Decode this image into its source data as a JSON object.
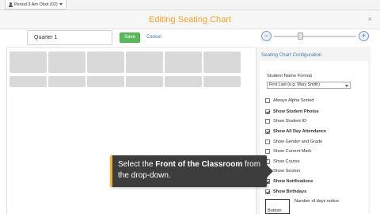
{
  "top_bar": {
    "period_label": "Period 3 Am Obot (02)"
  },
  "header": {
    "title": "Editing Seating Chart",
    "close_icon": "×"
  },
  "toolbar": {
    "chart_name_value": "Quarter 1",
    "save_label": "Save",
    "cancel_label": "Cancel",
    "zoom_out_symbol": "−",
    "zoom_in_symbol": "+",
    "zoom_level": 0.3
  },
  "sidebar": {
    "title": "Seating Chart Configuration",
    "name_format_label": "Student Name Format",
    "name_format_value": "First Last (e.g. Mary Smith)",
    "options": [
      {
        "label": "Always Alpha Sorted",
        "checked": false,
        "bold": false
      },
      {
        "label": "Show Student Photos",
        "checked": true,
        "bold": true
      },
      {
        "label": "Show Student ID",
        "checked": false,
        "bold": false
      },
      {
        "label": "Show All Day Attendance",
        "checked": true,
        "bold": true
      },
      {
        "label": "Show Gender and Grade",
        "checked": false,
        "bold": false
      },
      {
        "label": "Show Current Mark",
        "checked": false,
        "bold": false
      },
      {
        "label": "Show Course",
        "checked": false,
        "bold": false
      },
      {
        "label": "Show Section",
        "checked": false,
        "bold": false
      },
      {
        "label": "Show Notifications",
        "checked": true,
        "bold": true
      },
      {
        "label": "Show Birthdays",
        "checked": true,
        "bold": true
      }
    ],
    "days_notice_label": "Number of days notice",
    "front_value": "Bottom"
  },
  "callout": {
    "text_before": "Select the ",
    "text_bold": "Front of the Classroom",
    "text_after": " from the drop-down."
  },
  "colors": {
    "title": "#f0a030",
    "save": "#5cb85c",
    "link": "#337ab7",
    "callout_bg": "#3d3d3d",
    "callout_accent": "#f2b233"
  }
}
